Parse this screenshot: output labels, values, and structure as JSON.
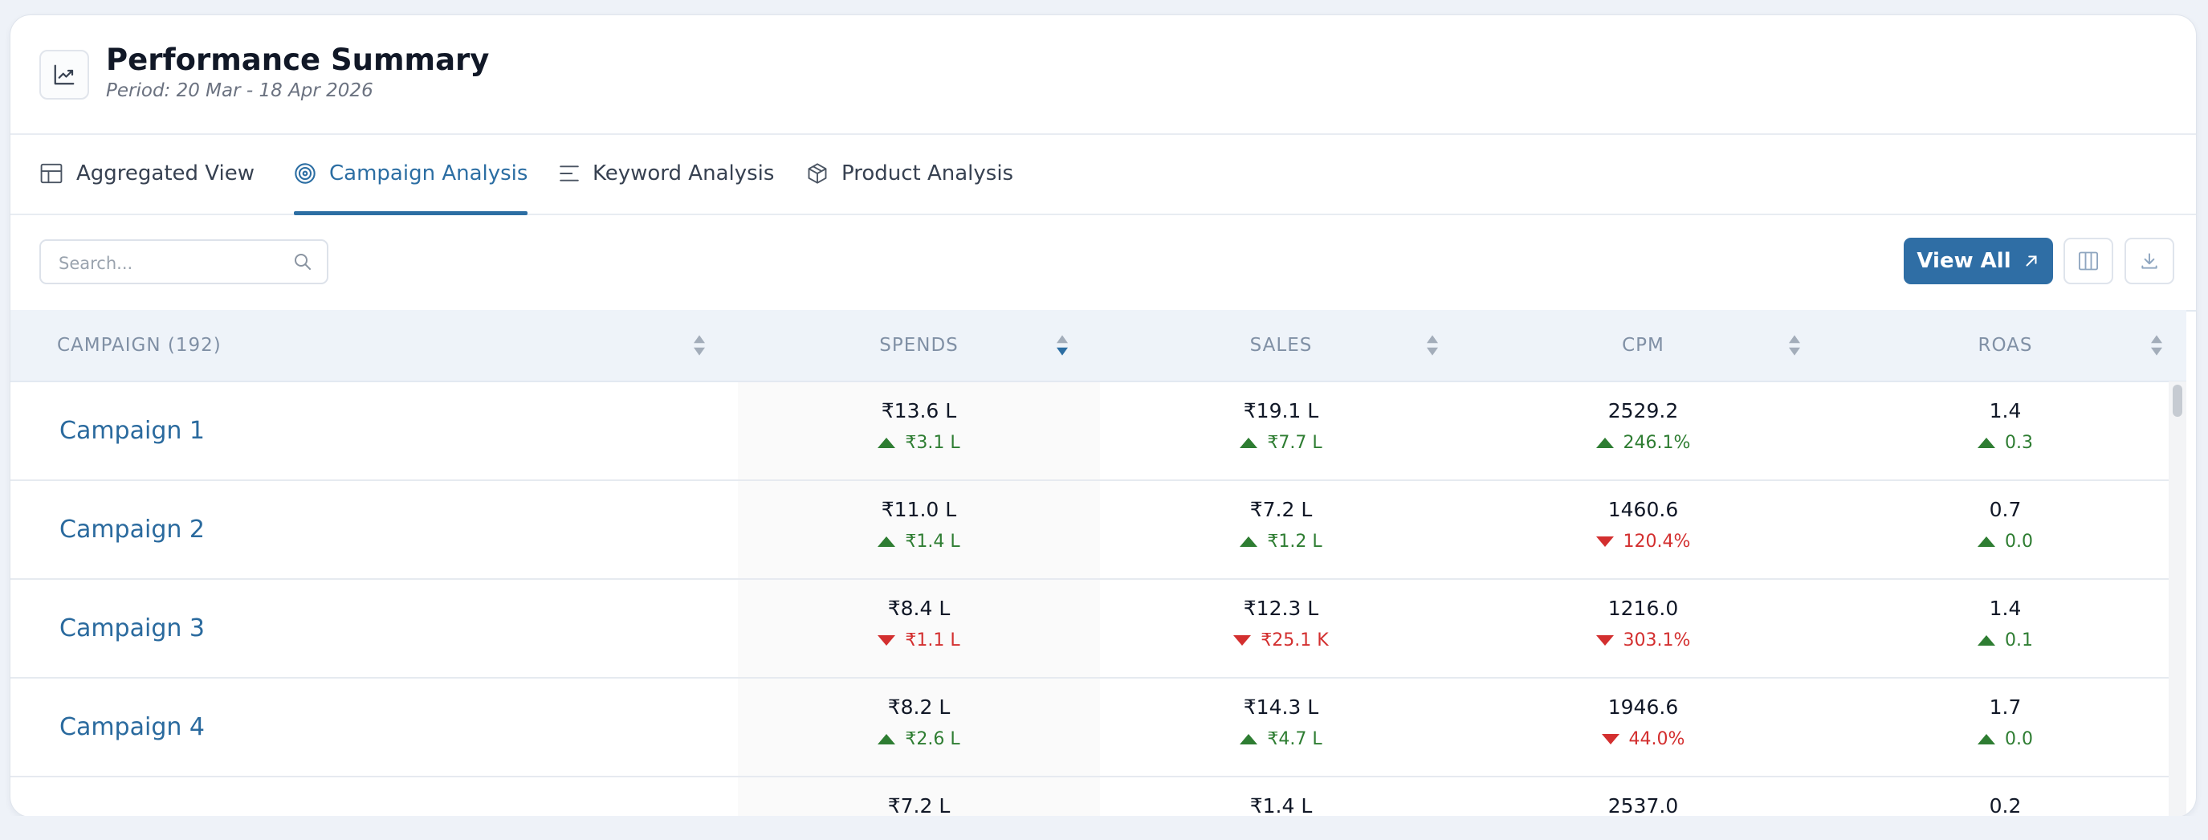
{
  "header": {
    "icon": "trend-chart-icon",
    "title": "Performance Summary",
    "period": "Period: 20 Mar - 18 Apr 2026"
  },
  "tabs": [
    {
      "label": "Aggregated View",
      "icon": "layout-grid-icon",
      "active": false
    },
    {
      "label": "Campaign Analysis",
      "icon": "target-icon",
      "active": true
    },
    {
      "label": "Keyword Analysis",
      "icon": "text-lines-icon",
      "active": false
    },
    {
      "label": "Product Analysis",
      "icon": "box-icon",
      "active": false
    }
  ],
  "toolbar": {
    "search_placeholder": "Search...",
    "view_all_label": "View All",
    "columns_button": "columns-icon",
    "download_button": "download-icon"
  },
  "table": {
    "columns": [
      "CAMPAIGN (192)",
      "SPENDS",
      "SALES",
      "CPM",
      "ROAS"
    ],
    "sorted_column": "SPENDS",
    "rows": [
      {
        "name": "Campaign 1",
        "spends": "₹13.6 L",
        "spends_delta": "₹3.1 L",
        "spends_dir": "up",
        "sales": "₹19.1 L",
        "sales_delta": "₹7.7 L",
        "sales_dir": "up",
        "cpm": "2529.2",
        "cpm_delta": "246.1%",
        "cpm_dir": "up",
        "roas": "1.4",
        "roas_delta": "0.3",
        "roas_dir": "up"
      },
      {
        "name": "Campaign 2",
        "spends": "₹11.0 L",
        "spends_delta": "₹1.4 L",
        "spends_dir": "up",
        "sales": "₹7.2 L",
        "sales_delta": "₹1.2 L",
        "sales_dir": "up",
        "cpm": "1460.6",
        "cpm_delta": "120.4%",
        "cpm_dir": "down",
        "roas": "0.7",
        "roas_delta": "0.0",
        "roas_dir": "up"
      },
      {
        "name": "Campaign 3",
        "spends": "₹8.4 L",
        "spends_delta": "₹1.1 L",
        "spends_dir": "down",
        "sales": "₹12.3 L",
        "sales_delta": "₹25.1 K",
        "sales_dir": "down",
        "cpm": "1216.0",
        "cpm_delta": "303.1%",
        "cpm_dir": "down",
        "roas": "1.4",
        "roas_delta": "0.1",
        "roas_dir": "up"
      },
      {
        "name": "Campaign 4",
        "spends": "₹8.2 L",
        "spends_delta": "₹2.6 L",
        "spends_dir": "up",
        "sales": "₹14.3 L",
        "sales_delta": "₹4.7 L",
        "sales_dir": "up",
        "cpm": "1946.6",
        "cpm_delta": "44.0%",
        "cpm_dir": "down",
        "roas": "1.7",
        "roas_delta": "0.0",
        "roas_dir": "up"
      },
      {
        "name": "",
        "spends": "₹7.2 L",
        "spends_delta": "",
        "spends_dir": "up",
        "sales": "₹1.4 L",
        "sales_delta": "",
        "sales_dir": "up",
        "cpm": "2537.0",
        "cpm_delta": "",
        "cpm_dir": "up",
        "roas": "0.2",
        "roas_delta": "",
        "roas_dir": "up"
      }
    ]
  },
  "colors": {
    "accent": "#2c6ea3",
    "up": "#2e7d32",
    "down": "#d32f2f",
    "header_bg": "#eef3f9"
  }
}
